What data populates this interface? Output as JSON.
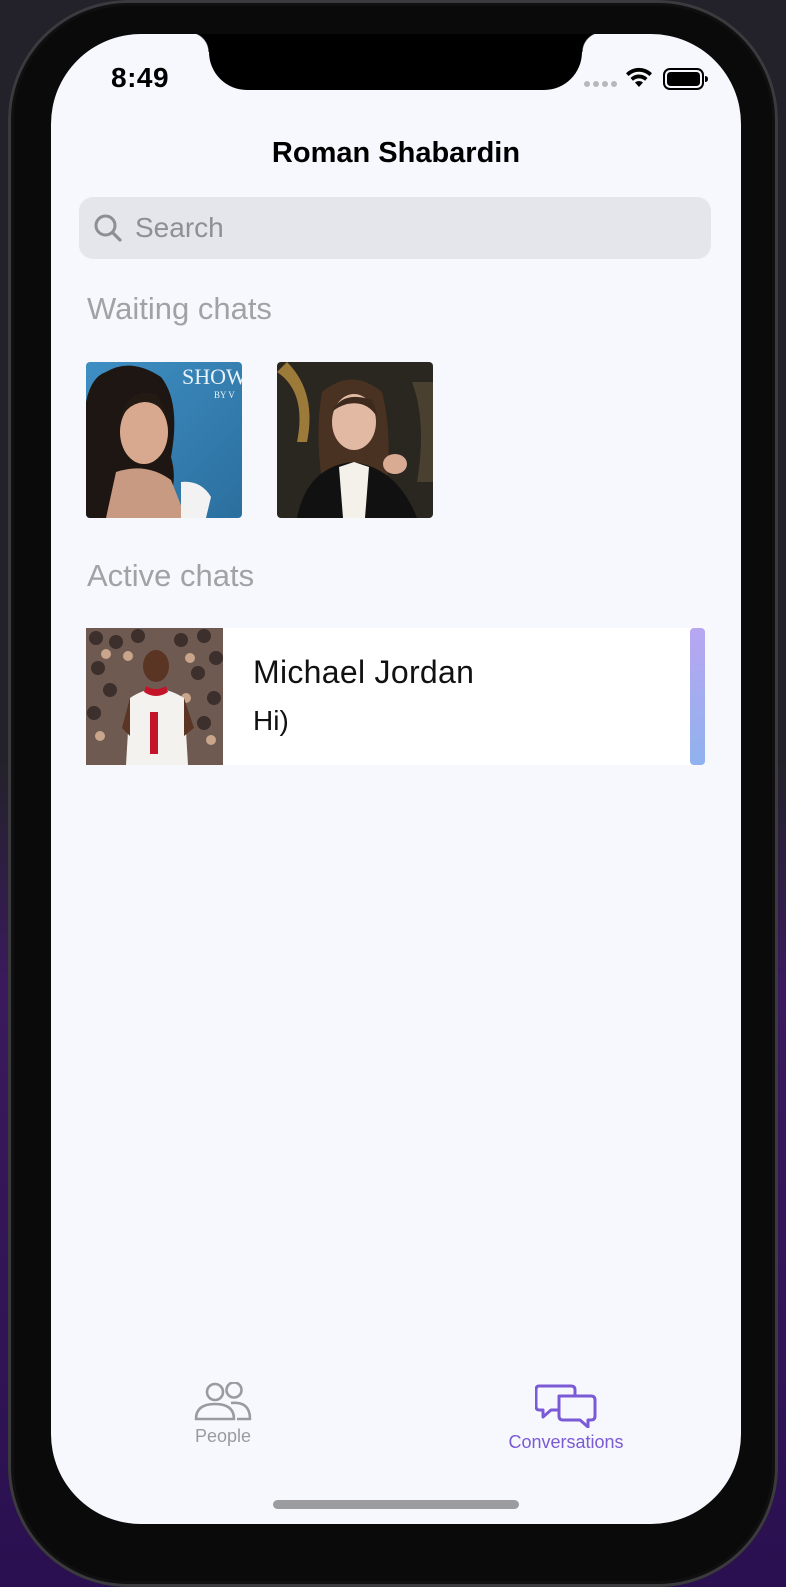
{
  "status_bar": {
    "time": "8:49"
  },
  "header": {
    "title": "Roman Shabardin"
  },
  "search": {
    "placeholder": "Search",
    "value": ""
  },
  "waiting_chats": {
    "heading": "Waiting chats",
    "avatars": [
      {
        "photo_text": "SHOW",
        "photo_subtext": "BY V"
      },
      {
        "photo_text": ""
      }
    ]
  },
  "active_chats": {
    "heading": "Active chats",
    "items": [
      {
        "name": "Michael Jordan",
        "last_message": "Hi)",
        "unread": true
      }
    ]
  },
  "tab_bar": {
    "tabs": [
      {
        "label": "People",
        "icon": "people-icon",
        "selected": false
      },
      {
        "label": "Conversations",
        "icon": "chat-bubbles-icon",
        "selected": true
      }
    ]
  },
  "colors": {
    "accent": "#7b5ad6",
    "background": "#f7f8fd",
    "search_background": "#e5e6ec",
    "section_heading": "#a2a2a6"
  }
}
